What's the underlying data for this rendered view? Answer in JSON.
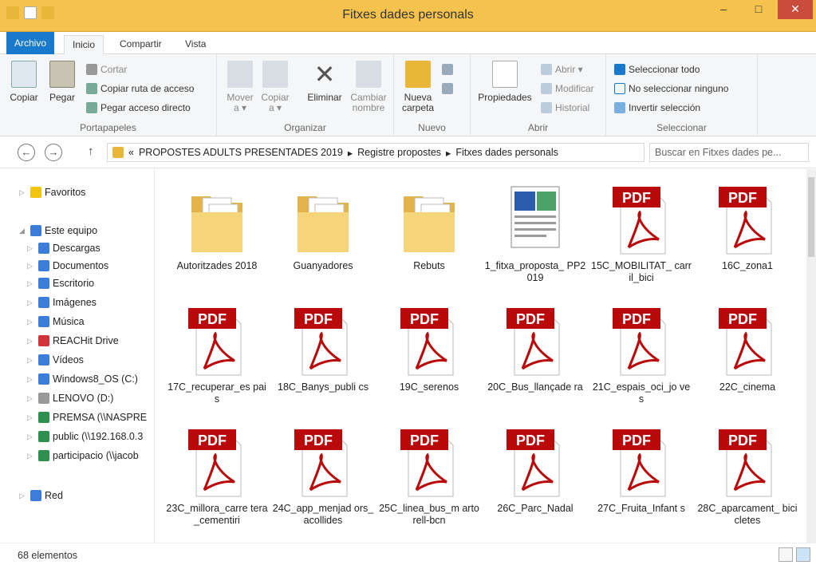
{
  "window": {
    "title": "Fitxes dades personals"
  },
  "tabs": [
    {
      "label": "Archivo"
    },
    {
      "label": "Inicio"
    },
    {
      "label": "Compartir"
    },
    {
      "label": "Vista"
    }
  ],
  "ribbon": {
    "portapapeles": {
      "copiar": "Copiar",
      "pegar": "Pegar",
      "cortar": "Cortar",
      "copiar_ruta": "Copiar ruta de acceso",
      "pegar_acceso": "Pegar acceso directo",
      "group": "Portapapeles"
    },
    "organizar": {
      "mover": "Mover",
      "mover2": "a ▾",
      "copiar": "Copiar",
      "copiar2": "a ▾",
      "eliminar": "Eliminar",
      "cambiar": "Cambiar",
      "nombre": "nombre",
      "group": "Organizar"
    },
    "nuevo": {
      "nueva": "Nueva",
      "carpeta": "carpeta",
      "group": "Nuevo"
    },
    "abrir": {
      "propiedades": "Propiedades",
      "abrir": "Abrir ▾",
      "modificar": "Modificar",
      "historial": "Historial",
      "group": "Abrir"
    },
    "seleccionar": {
      "todo": "Seleccionar todo",
      "ninguno": "No seleccionar ninguno",
      "invertir": "Invertir selección",
      "group": "Seleccionar"
    }
  },
  "address": {
    "sep": "«",
    "crumbs": [
      "PROPOSTES ADULTS PRESENTADES 2019",
      "Registre propostes",
      "Fitxes dades personals"
    ],
    "search_placeholder": "Buscar en Fitxes dades pe..."
  },
  "nav": [
    "Favoritos",
    "Este equipo",
    "Descargas",
    "Documentos",
    "Escritorio",
    "Imágenes",
    "Música",
    "REACHit Drive",
    "Vídeos",
    "Windows8_OS (C:)",
    "LENOVO (D:)",
    "PREMSA (\\\\NASPRE",
    "public (\\\\192.168.0.3",
    "participacio (\\\\jacob",
    "Red"
  ],
  "files": [
    {
      "name": "Autoritzades 2018",
      "type": "folder"
    },
    {
      "name": "Guanyadores",
      "type": "folder"
    },
    {
      "name": "Rebuts",
      "type": "folder"
    },
    {
      "name": "1_fitxa_proposta_ PP2019",
      "type": "word"
    },
    {
      "name": "15C_MOBILITAT_ carril_bici",
      "type": "pdf"
    },
    {
      "name": "16C_zona1",
      "type": "pdf"
    },
    {
      "name": "17C_recuperar_es pais",
      "type": "pdf"
    },
    {
      "name": "18C_Banys_publi cs",
      "type": "pdf"
    },
    {
      "name": "19C_serenos",
      "type": "pdf"
    },
    {
      "name": "20C_Bus_llançade ra",
      "type": "pdf"
    },
    {
      "name": "21C_espais_oci_jo ves",
      "type": "pdf"
    },
    {
      "name": "22C_cinema",
      "type": "pdf"
    },
    {
      "name": "23C_millora_carre tera_cementiri",
      "type": "pdf"
    },
    {
      "name": "24C_app_menjad ors_acollides",
      "type": "pdf"
    },
    {
      "name": "25C_linea_bus_m artorell-bcn",
      "type": "pdf"
    },
    {
      "name": "26C_Parc_Nadal",
      "type": "pdf"
    },
    {
      "name": "27C_Fruita_Infant s",
      "type": "pdf"
    },
    {
      "name": "28C_aparcament_ bicicletes",
      "type": "pdf"
    }
  ],
  "icon_labels": {
    "pdf": "PDF"
  },
  "status": {
    "count": "68 elementos"
  }
}
